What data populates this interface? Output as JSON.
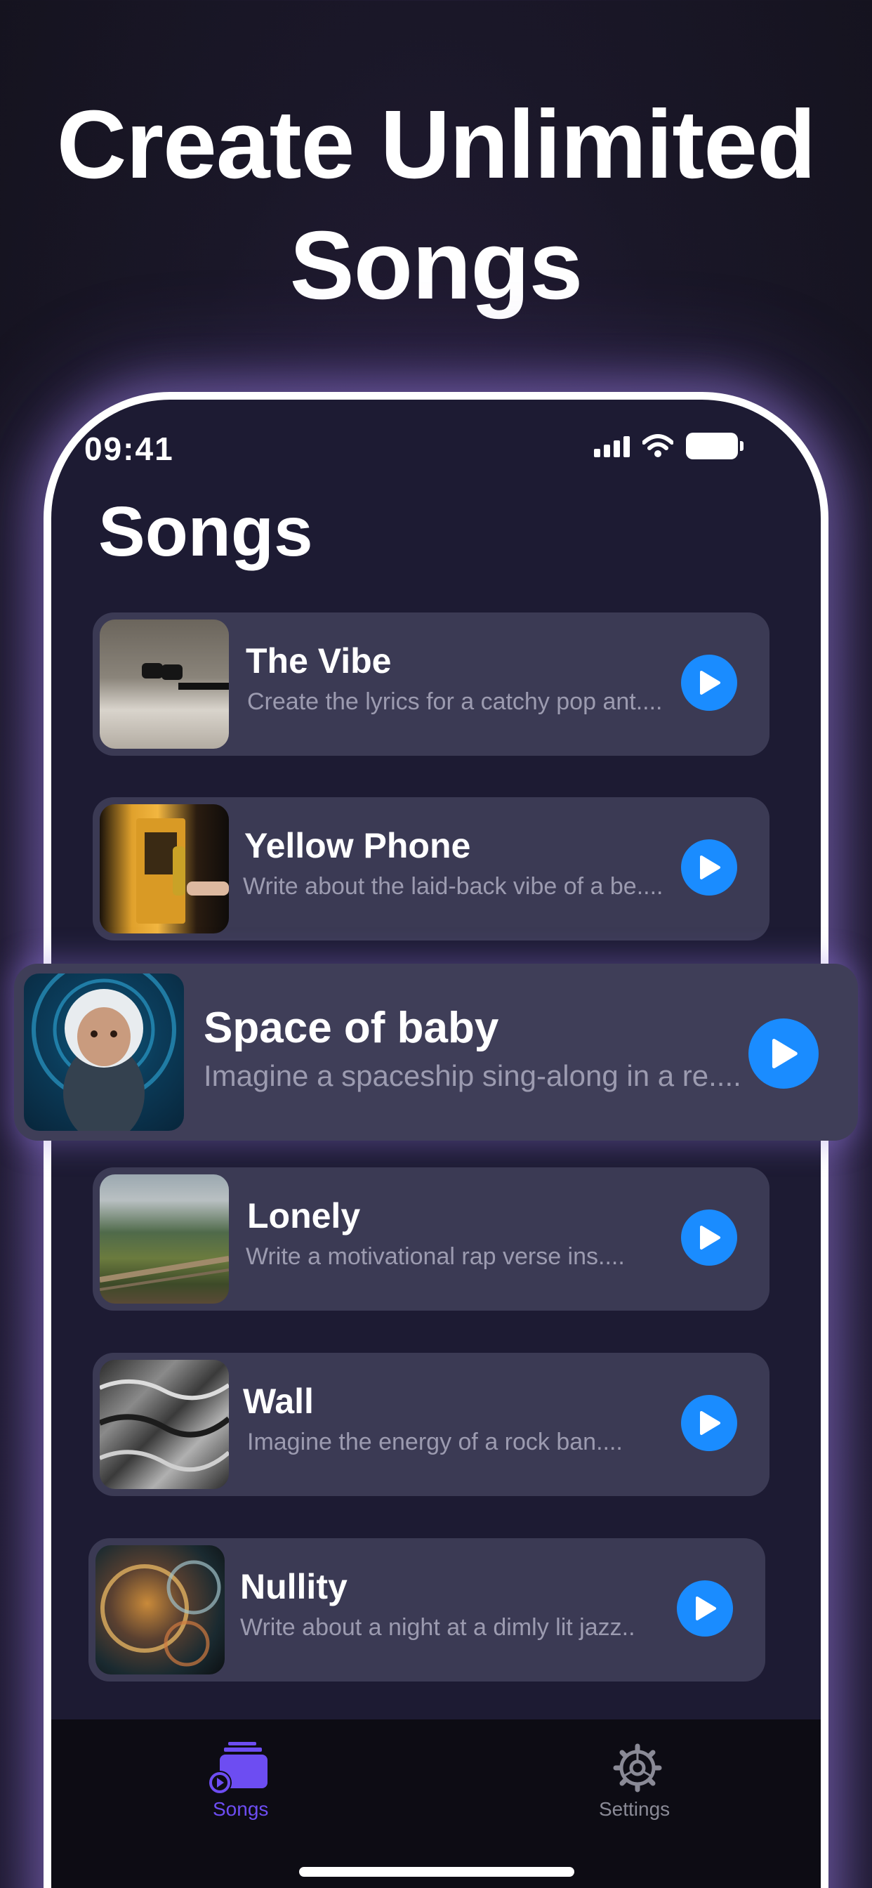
{
  "headline": {
    "line1": "Create Unlimited",
    "line2": "Songs"
  },
  "status_bar": {
    "time": "09:41"
  },
  "page": {
    "title": "Songs"
  },
  "songs": [
    {
      "title": "The Vibe",
      "subtitle": "Create the lyrics for a catchy pop ant....",
      "thumb_icon": "sneakers-photo"
    },
    {
      "title": "Yellow Phone",
      "subtitle": "Write about the laid-back vibe of a be....",
      "thumb_icon": "payphone-photo"
    },
    {
      "title": "Space of baby",
      "subtitle": "Imagine a spaceship sing-along in a re....",
      "thumb_icon": "astronaut-baby-photo"
    },
    {
      "title": "Lonely",
      "subtitle": "Write a motivational rap verse ins....",
      "thumb_icon": "dunes-photo"
    },
    {
      "title": "Wall",
      "subtitle": "Imagine the energy of a rock ban....",
      "thumb_icon": "rock-texture-photo"
    },
    {
      "title": "Nullity",
      "subtitle": "Write about a night at a dimly lit jazz..",
      "thumb_icon": "bubbles-photo"
    }
  ],
  "tabs": [
    {
      "label": "Songs",
      "icon": "songs-stack-icon",
      "active": true
    },
    {
      "label": "Settings",
      "icon": "gear-icon",
      "active": false
    }
  ],
  "colors": {
    "accent": "#1a8cff",
    "active_tab": "#6d4df2",
    "card": "#3b3a54",
    "background": "#1d1b33"
  }
}
